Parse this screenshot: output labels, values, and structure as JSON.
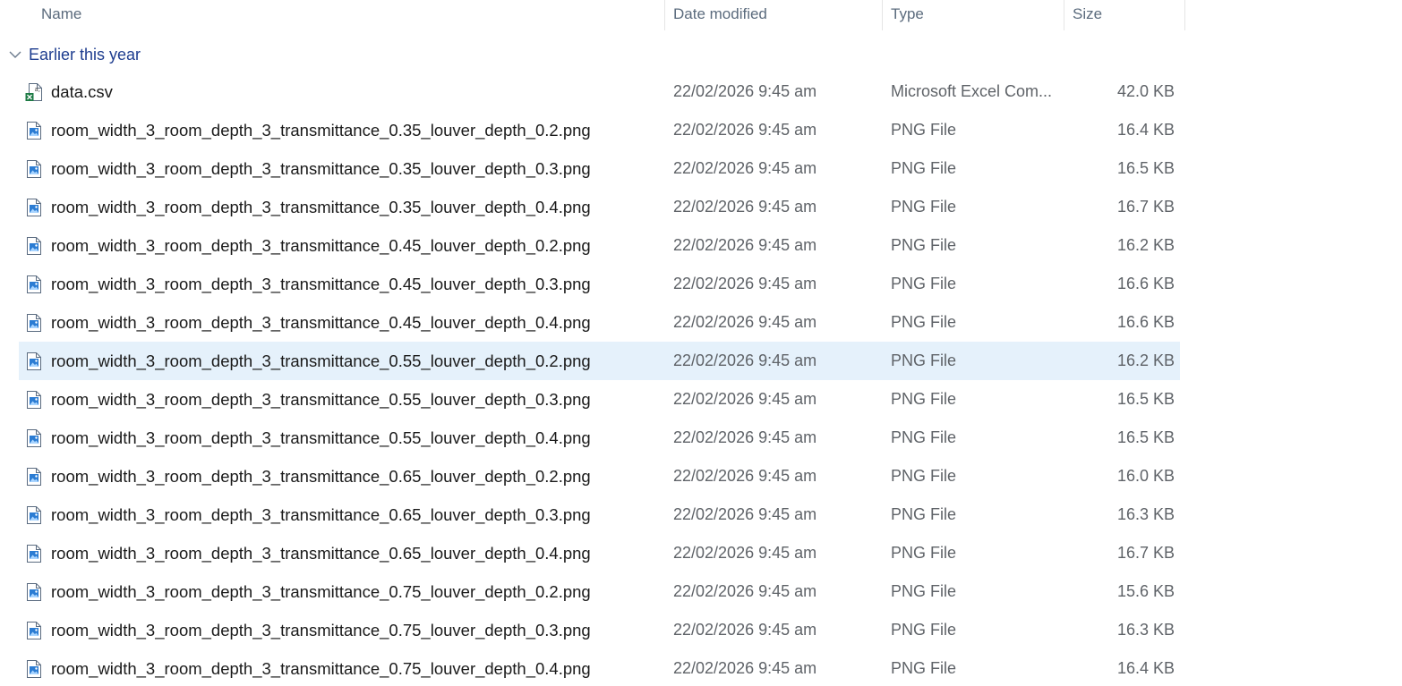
{
  "columns": {
    "name": "Name",
    "date": "Date modified",
    "type": "Type",
    "size": "Size"
  },
  "group": {
    "label": "Earlier this year",
    "expanded": true
  },
  "selection_color": "#e5f1fb",
  "files": [
    {
      "name": "data.csv",
      "date": "22/02/2026 9:45 am",
      "type": "Microsoft Excel Com...",
      "size": "42.0 KB",
      "icon": "excel-csv-icon",
      "selected": false
    },
    {
      "name": "room_width_3_room_depth_3_transmittance_0.35_louver_depth_0.2.png",
      "date": "22/02/2026 9:45 am",
      "type": "PNG File",
      "size": "16.4 KB",
      "icon": "png-file-icon",
      "selected": false
    },
    {
      "name": "room_width_3_room_depth_3_transmittance_0.35_louver_depth_0.3.png",
      "date": "22/02/2026 9:45 am",
      "type": "PNG File",
      "size": "16.5 KB",
      "icon": "png-file-icon",
      "selected": false
    },
    {
      "name": "room_width_3_room_depth_3_transmittance_0.35_louver_depth_0.4.png",
      "date": "22/02/2026 9:45 am",
      "type": "PNG File",
      "size": "16.7 KB",
      "icon": "png-file-icon",
      "selected": false
    },
    {
      "name": "room_width_3_room_depth_3_transmittance_0.45_louver_depth_0.2.png",
      "date": "22/02/2026 9:45 am",
      "type": "PNG File",
      "size": "16.2 KB",
      "icon": "png-file-icon",
      "selected": false
    },
    {
      "name": "room_width_3_room_depth_3_transmittance_0.45_louver_depth_0.3.png",
      "date": "22/02/2026 9:45 am",
      "type": "PNG File",
      "size": "16.6 KB",
      "icon": "png-file-icon",
      "selected": false
    },
    {
      "name": "room_width_3_room_depth_3_transmittance_0.45_louver_depth_0.4.png",
      "date": "22/02/2026 9:45 am",
      "type": "PNG File",
      "size": "16.6 KB",
      "icon": "png-file-icon",
      "selected": false
    },
    {
      "name": "room_width_3_room_depth_3_transmittance_0.55_louver_depth_0.2.png",
      "date": "22/02/2026 9:45 am",
      "type": "PNG File",
      "size": "16.2 KB",
      "icon": "png-file-icon",
      "selected": true
    },
    {
      "name": "room_width_3_room_depth_3_transmittance_0.55_louver_depth_0.3.png",
      "date": "22/02/2026 9:45 am",
      "type": "PNG File",
      "size": "16.5 KB",
      "icon": "png-file-icon",
      "selected": false
    },
    {
      "name": "room_width_3_room_depth_3_transmittance_0.55_louver_depth_0.4.png",
      "date": "22/02/2026 9:45 am",
      "type": "PNG File",
      "size": "16.5 KB",
      "icon": "png-file-icon",
      "selected": false
    },
    {
      "name": "room_width_3_room_depth_3_transmittance_0.65_louver_depth_0.2.png",
      "date": "22/02/2026 9:45 am",
      "type": "PNG File",
      "size": "16.0 KB",
      "icon": "png-file-icon",
      "selected": false
    },
    {
      "name": "room_width_3_room_depth_3_transmittance_0.65_louver_depth_0.3.png",
      "date": "22/02/2026 9:45 am",
      "type": "PNG File",
      "size": "16.3 KB",
      "icon": "png-file-icon",
      "selected": false
    },
    {
      "name": "room_width_3_room_depth_3_transmittance_0.65_louver_depth_0.4.png",
      "date": "22/02/2026 9:45 am",
      "type": "PNG File",
      "size": "16.7 KB",
      "icon": "png-file-icon",
      "selected": false
    },
    {
      "name": "room_width_3_room_depth_3_transmittance_0.75_louver_depth_0.2.png",
      "date": "22/02/2026 9:45 am",
      "type": "PNG File",
      "size": "15.6 KB",
      "icon": "png-file-icon",
      "selected": false
    },
    {
      "name": "room_width_3_room_depth_3_transmittance_0.75_louver_depth_0.3.png",
      "date": "22/02/2026 9:45 am",
      "type": "PNG File",
      "size": "16.3 KB",
      "icon": "png-file-icon",
      "selected": false
    },
    {
      "name": "room_width_3_room_depth_3_transmittance_0.75_louver_depth_0.4.png",
      "date": "22/02/2026 9:45 am",
      "type": "PNG File",
      "size": "16.4 KB",
      "icon": "png-file-icon",
      "selected": false
    }
  ]
}
